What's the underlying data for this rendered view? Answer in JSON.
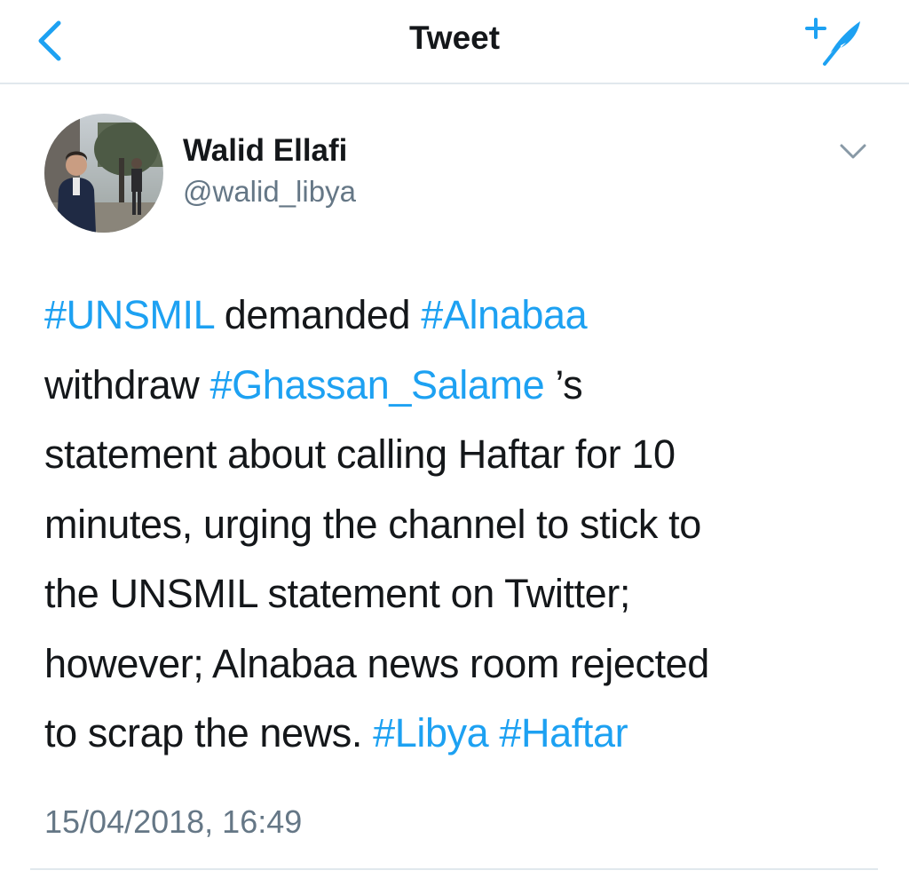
{
  "navbar": {
    "title": "Tweet",
    "back_icon": "chevron-left-icon",
    "compose_icon": "compose-tweet-icon"
  },
  "tweet": {
    "author": {
      "display_name": "Walid Ellafi",
      "handle": "@walid_libya"
    },
    "menu_icon": "chevron-down-icon",
    "text_lines": [
      [
        {
          "t": "#UNSMIL",
          "h": true
        },
        {
          "t": " demanded ",
          "h": false
        },
        {
          "t": "#Alnabaa",
          "h": true
        }
      ],
      [
        {
          "t": "withdraw ",
          "h": false
        },
        {
          "t": "#Ghassan_Salame",
          "h": true
        },
        {
          "t": " ’s",
          "h": false
        }
      ],
      [
        {
          "t": "statement about calling Haftar for 10",
          "h": false
        }
      ],
      [
        {
          "t": "minutes, urging the channel to stick to",
          "h": false
        }
      ],
      [
        {
          "t": "the UNSMIL statement on Twitter;",
          "h": false
        }
      ],
      [
        {
          "t": "however; Alnabaa news room rejected",
          "h": false
        }
      ],
      [
        {
          "t": "to scrap the news. ",
          "h": false
        },
        {
          "t": "#Libya",
          "h": true
        },
        {
          "t": " ",
          "h": false
        },
        {
          "t": "#Haftar",
          "h": true
        }
      ]
    ],
    "timestamp": "15/04/2018, 16:49"
  },
  "colors": {
    "accent": "#1da1f2",
    "text": "#14171a",
    "secondary": "#657786",
    "divider": "#e1e8ed"
  }
}
